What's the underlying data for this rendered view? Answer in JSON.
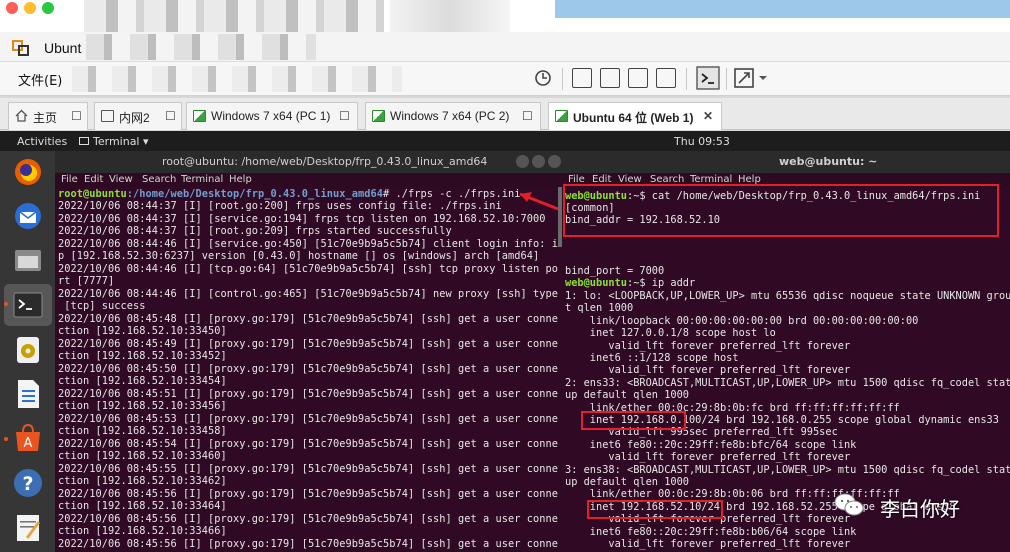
{
  "host": {
    "vm_title_fragment": "Ubunt",
    "menu_file": "文件(E)"
  },
  "tabs": [
    {
      "label": "主页"
    },
    {
      "label": "内网2"
    },
    {
      "label": "Windows 7 x64 (PC 1)"
    },
    {
      "label": "Windows 7 x64 (PC 2)"
    },
    {
      "label": "Ubuntu 64 位 (Web 1)"
    }
  ],
  "ubuntu": {
    "activities": "Activities",
    "terminal_menu": "Terminal ▾",
    "clock": "Thu 09:53"
  },
  "terminal_left": {
    "title": "root@ubuntu: /home/web/Desktop/frp_0.43.0_linux_amd64",
    "menu": [
      "File",
      "Edit",
      "View",
      "Search",
      "Terminal",
      "Help"
    ],
    "prompt_user": "root@ubuntu",
    "prompt_path": ":/home/web/Desktop/frp_0.43.0_linux_amd64",
    "command": "# ./frps -c ./frps.ini",
    "lines": [
      "2022/10/06 08:44:37 [I] [root.go:200] frps uses config file: ./frps.ini",
      "2022/10/06 08:44:37 [I] [service.go:194] frps tcp listen on 192.168.52.10:7000",
      "2022/10/06 08:44:37 [I] [root.go:209] frps started successfully",
      "2022/10/06 08:44:46 [I] [service.go:450] [51c70e9b9a5c5b74] client login info: i",
      "p [192.168.52.30:6237] version [0.43.0] hostname [] os [windows] arch [amd64]",
      "2022/10/06 08:44:46 [I] [tcp.go:64] [51c70e9b9a5c5b74] [ssh] tcp proxy listen po",
      "rt [7777]",
      "2022/10/06 08:44:46 [I] [control.go:465] [51c70e9b9a5c5b74] new proxy [ssh] type",
      " [tcp] success",
      "2022/10/06 08:45:48 [I] [proxy.go:179] [51c70e9b9a5c5b74] [ssh] get a user conne",
      "ction [192.168.52.10:33450]",
      "2022/10/06 08:45:49 [I] [proxy.go:179] [51c70e9b9a5c5b74] [ssh] get a user conne",
      "ction [192.168.52.10:33452]",
      "2022/10/06 08:45:50 [I] [proxy.go:179] [51c70e9b9a5c5b74] [ssh] get a user conne",
      "ction [192.168.52.10:33454]",
      "2022/10/06 08:45:51 [I] [proxy.go:179] [51c70e9b9a5c5b74] [ssh] get a user conne",
      "ction [192.168.52.10:33456]",
      "2022/10/06 08:45:53 [I] [proxy.go:179] [51c70e9b9a5c5b74] [ssh] get a user conne",
      "ction [192.168.52.10:33458]",
      "2022/10/06 08:45:54 [I] [proxy.go:179] [51c70e9b9a5c5b74] [ssh] get a user conne",
      "ction [192.168.52.10:33460]",
      "2022/10/06 08:45:55 [I] [proxy.go:179] [51c70e9b9a5c5b74] [ssh] get a user conne",
      "ction [192.168.52.10:33462]",
      "2022/10/06 08:45:56 [I] [proxy.go:179] [51c70e9b9a5c5b74] [ssh] get a user conne",
      "ction [192.168.52.10:33464]",
      "2022/10/06 08:45:56 [I] [proxy.go:179] [51c70e9b9a5c5b74] [ssh] get a user conne",
      "ction [192.168.52.10:33466]",
      "2022/10/06 08:45:56 [I] [proxy.go:179] [51c70e9b9a5c5b74] [ssh] get a user conne"
    ]
  },
  "terminal_right": {
    "title": "web@ubuntu: ~",
    "menu": [
      "File",
      "Edit",
      "View",
      "Search",
      "Terminal",
      "Help"
    ],
    "prompt1_user": "web@ubuntu",
    "prompt1_rest": ":~$ cat /home/web/Desktop/frp_0.43.0_linux_amd64/frps.ini",
    "cfg_common": "[common]",
    "cfg_bind_addr": "bind_addr = 192.168.52.10",
    "cfg_bind_port": "bind_port = 7000",
    "prompt2_user": "web@ubuntu",
    "prompt2_rest": ":~$ ip addr",
    "lines": [
      "1: lo: <LOOPBACK,UP,LOWER_UP> mtu 65536 qdisc noqueue state UNKNOWN grou",
      "t qlen 1000",
      "    link/loopback 00:00:00:00:00:00 brd 00:00:00:00:00:00",
      "    inet 127.0.0.1/8 scope host lo",
      "       valid_lft forever preferred_lft forever",
      "    inet6 ::1/128 scope host",
      "       valid_lft forever preferred_lft forever",
      "2: ens33: <BROADCAST,MULTICAST,UP,LOWER_UP> mtu 1500 qdisc fq_codel stat",
      "up default qlen 1000",
      "    link/ether 00:0c:29:8b:0b:fc brd ff:ff:ff:ff:ff:ff",
      "    inet 192.168.0.100/24 brd 192.168.0.255 scope global dynamic ens33",
      "       valid_lft 995sec preferred_lft 995sec",
      "    inet6 fe80::20c:29ff:fe8b:bfc/64 scope link",
      "       valid_lft forever preferred_lft forever",
      "3: ens38: <BROADCAST,MULTICAST,UP,LOWER_UP> mtu 1500 qdisc fq_codel stat",
      "up default qlen 1000",
      "    link/ether 00:0c:29:8b:0b:06 brd ff:ff:ff:ff:ff:ff",
      "    inet 192.168.52.10/24 brd 192.168.52.255 scope global ens38",
      "       valid_lft forever preferred_lft forever",
      "    inet6 fe80::20c:29ff:fe8b:b06/64 scope link",
      "       valid_lft forever preferred_lft forever"
    ]
  },
  "watermark": {
    "text": "李白你好"
  },
  "colors": {
    "terminal_bg": "#300a24",
    "prompt_green": "#8ae234",
    "path_blue": "#729fcf",
    "annotation_red": "#e0202a"
  }
}
